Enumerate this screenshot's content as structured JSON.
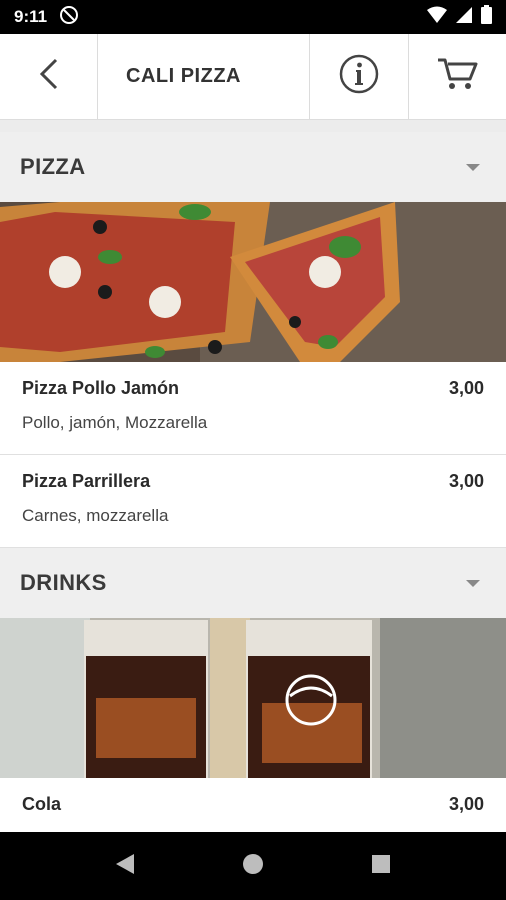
{
  "status_bar": {
    "time": "9:11"
  },
  "header": {
    "title": "CALI PIZZA",
    "back_icon": "back-arrow-icon",
    "info_icon": "info-icon",
    "cart_icon": "cart-icon"
  },
  "sections": [
    {
      "label": "PIZZA",
      "items": [
        {
          "name": "Pizza Pollo Jamón",
          "price": "3,00",
          "description": "Pollo, jamón, Mozzarella"
        },
        {
          "name": "Pizza Parrillera",
          "price": "3,00",
          "description": "Carnes, mozzarella"
        }
      ]
    },
    {
      "label": "DRINKS",
      "items": [
        {
          "name": "Cola",
          "price": "3,00"
        }
      ]
    }
  ],
  "colors": {
    "header_bg": "#ffffff",
    "section_bg": "#efefef",
    "status_bg": "#000000"
  }
}
